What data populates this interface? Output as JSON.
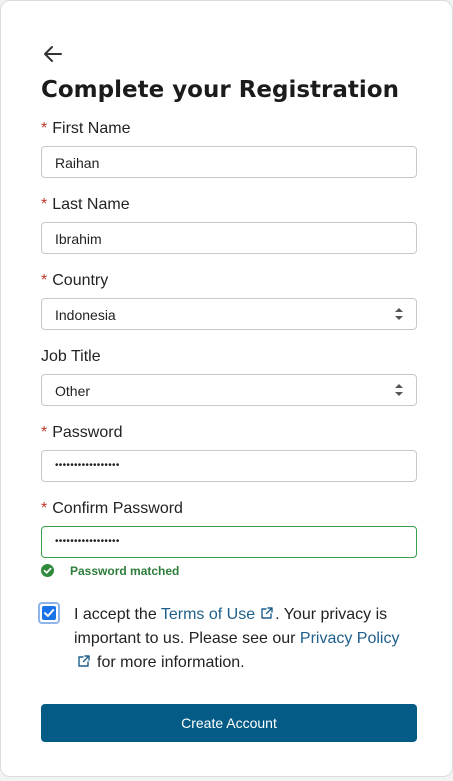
{
  "page": {
    "title": "Complete your Registration"
  },
  "form": {
    "required_marker": "*",
    "first_name": {
      "label": "First Name",
      "value": "Raihan",
      "required": true
    },
    "last_name": {
      "label": "Last Name",
      "value": "Ibrahim",
      "required": true
    },
    "country": {
      "label": "Country",
      "value": "Indonesia",
      "required": true
    },
    "job_title": {
      "label": "Job Title",
      "value": "Other",
      "required": false
    },
    "password": {
      "label": "Password",
      "masked": "•••••••••••••••••",
      "required": true
    },
    "confirm_password": {
      "label": "Confirm Password",
      "masked": "•••••••••••••••••",
      "required": true
    },
    "password_status": "Password matched"
  },
  "consent": {
    "checked": true,
    "prefix": "I accept the",
    "terms_link": "Terms of Use",
    "middle": ". Your privacy is important to us. Please see our",
    "privacy_link": "Privacy Policy",
    "suffix": "for more information."
  },
  "submit_label": "Create Account",
  "colors": {
    "primary_button": "#045b86",
    "link": "#1d5f8a",
    "success": "#2f7d3b",
    "required": "#c0392b",
    "checkbox": "#1a73e8"
  },
  "icons": {
    "back": "arrow-left-icon",
    "select": "chevron-updown-icon",
    "success": "check-circle-icon",
    "external": "external-link-icon"
  }
}
